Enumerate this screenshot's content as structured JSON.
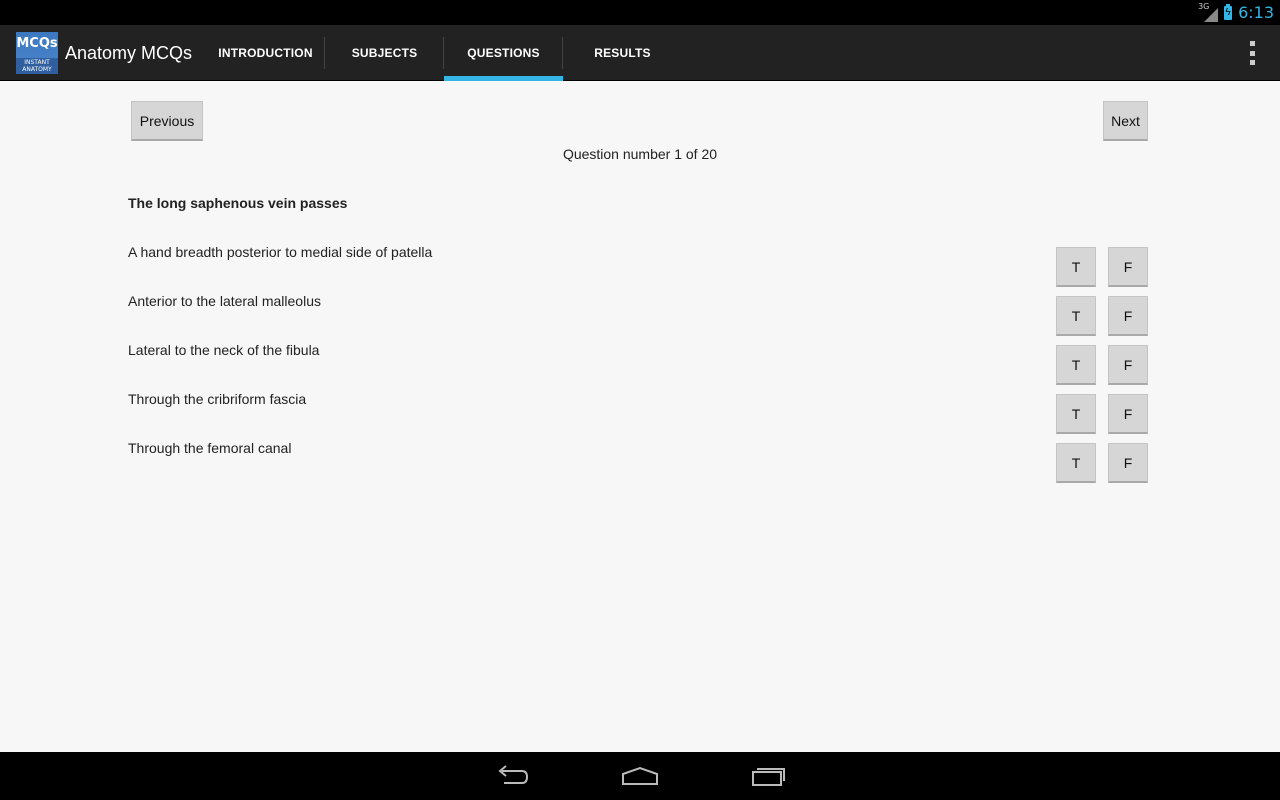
{
  "status_bar": {
    "network": "3G",
    "time": "6:13"
  },
  "action_bar": {
    "logo_text": "MCQs",
    "logo_subtext": "INSTANT ANATOMY",
    "title": "Anatomy MCQs",
    "tabs": [
      {
        "label": "INTRODUCTION",
        "active": false
      },
      {
        "label": "SUBJECTS",
        "active": false
      },
      {
        "label": "QUESTIONS",
        "active": true
      },
      {
        "label": "RESULTS",
        "active": false
      }
    ]
  },
  "quiz": {
    "previous_label": "Previous",
    "next_label": "Next",
    "question_number": "Question number 1 of 20",
    "question": "The long saphenous vein passes",
    "true_label": "T",
    "false_label": "F",
    "options": [
      "A hand breadth posterior to medial side of patella",
      "Anterior to the lateral malleolus",
      "Lateral to the neck of the fibula",
      "Through the cribriform fascia",
      "Through the femoral canal"
    ]
  },
  "colors": {
    "accent": "#33b5e5",
    "action_bar": "#222222",
    "background": "#f7f7f7",
    "button": "#d6d6d6"
  }
}
